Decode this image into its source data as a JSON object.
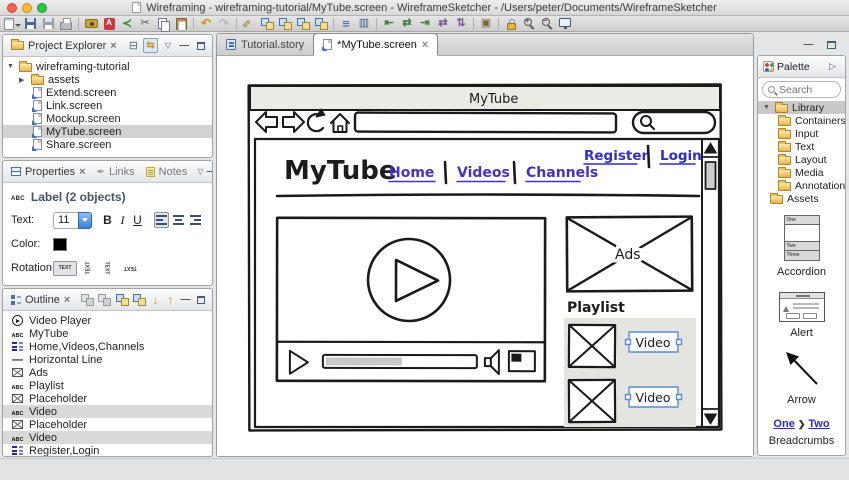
{
  "titlebar": {
    "title": "Wireframing - wireframing-tutorial/MyTube.screen - WireframeSketcher - /Users/peter/Documents/WireframeSketcher"
  },
  "toolbar": {
    "icons": [
      "new-file",
      "save",
      "save-all",
      "print",
      "screenshot-camera",
      "export-pdf",
      "share",
      "cut",
      "copy",
      "paste",
      "undo",
      "redo",
      "edit-wand",
      "group",
      "ungroup",
      "bring-forward",
      "send-backward",
      "storyboard",
      "columns",
      "align-left",
      "align-center",
      "align-right",
      "distribute-horizontal",
      "distribute-vertical",
      "match-size",
      "lock",
      "zoom-in",
      "zoom-out",
      "presentation"
    ]
  },
  "project_explorer": {
    "title": "Project Explorer",
    "items": [
      {
        "label": "wireframing-tutorial"
      },
      {
        "label": "assets"
      },
      {
        "label": "Extend.screen"
      },
      {
        "label": "Link.screen"
      },
      {
        "label": "Mockup.screen"
      },
      {
        "label": "MyTube.screen"
      },
      {
        "label": "Share.screen"
      }
    ]
  },
  "properties": {
    "tab_properties": "Properties",
    "tab_links": "Links",
    "tab_notes": "Notes",
    "header": "Label (2 objects)",
    "text_label": "Text:",
    "font_size": "11",
    "bold": "B",
    "italic": "I",
    "underline": "U",
    "color_label": "Color:",
    "color_value": "#000000",
    "rotation_label": "Rotation:",
    "rotation_glyph": "TEXT"
  },
  "outline": {
    "title": "Outline",
    "items": [
      {
        "label": "Video Player",
        "icon": "video-player"
      },
      {
        "label": "MyTube",
        "icon": "label"
      },
      {
        "label": "Home,Videos,Channels",
        "icon": "link-bar"
      },
      {
        "label": "Horizontal Line",
        "icon": "horizontal-line"
      },
      {
        "label": "Ads",
        "icon": "placeholder"
      },
      {
        "label": "Playlist",
        "icon": "label"
      },
      {
        "label": "Placeholder",
        "icon": "placeholder"
      },
      {
        "label": "Video",
        "icon": "label",
        "selected": true
      },
      {
        "label": "Placeholder",
        "icon": "placeholder"
      },
      {
        "label": "Video",
        "icon": "label",
        "selected": true
      },
      {
        "label": "Register,Login",
        "icon": "link-bar"
      }
    ]
  },
  "editor": {
    "tabs": [
      {
        "label": "Tutorial.story"
      },
      {
        "label": "*MyTube.screen"
      }
    ]
  },
  "wireframe": {
    "window_title": "MyTube",
    "logo": "MyTube",
    "nav": [
      "Home",
      "Videos",
      "Channels"
    ],
    "account_links": [
      "Register",
      "Login"
    ],
    "ads_label": "Ads",
    "playlist_title": "Playlist",
    "video_labels": [
      "Video",
      "Video"
    ]
  },
  "palette": {
    "title": "Palette",
    "search_placeholder": "Search",
    "tree": [
      {
        "label": "Library"
      },
      {
        "label": "Containers"
      },
      {
        "label": "Input"
      },
      {
        "label": "Text"
      },
      {
        "label": "Layout"
      },
      {
        "label": "Media"
      },
      {
        "label": "Annotations"
      },
      {
        "label": "Assets"
      }
    ],
    "components": [
      {
        "name": "Accordion",
        "rows": [
          "One",
          "Two",
          "Three"
        ]
      },
      {
        "name": "Alert"
      },
      {
        "name": "Arrow"
      },
      {
        "name": "Breadcrumbs",
        "crumbs": [
          "One",
          "Two"
        ]
      }
    ]
  },
  "colors": {
    "selection_blue": "#5b8cd6",
    "wireframe_link_blue": "#2d2dd0",
    "wireframe_nav_purple": "#4431cc",
    "sketch_stroke": "#1a1a1a"
  }
}
